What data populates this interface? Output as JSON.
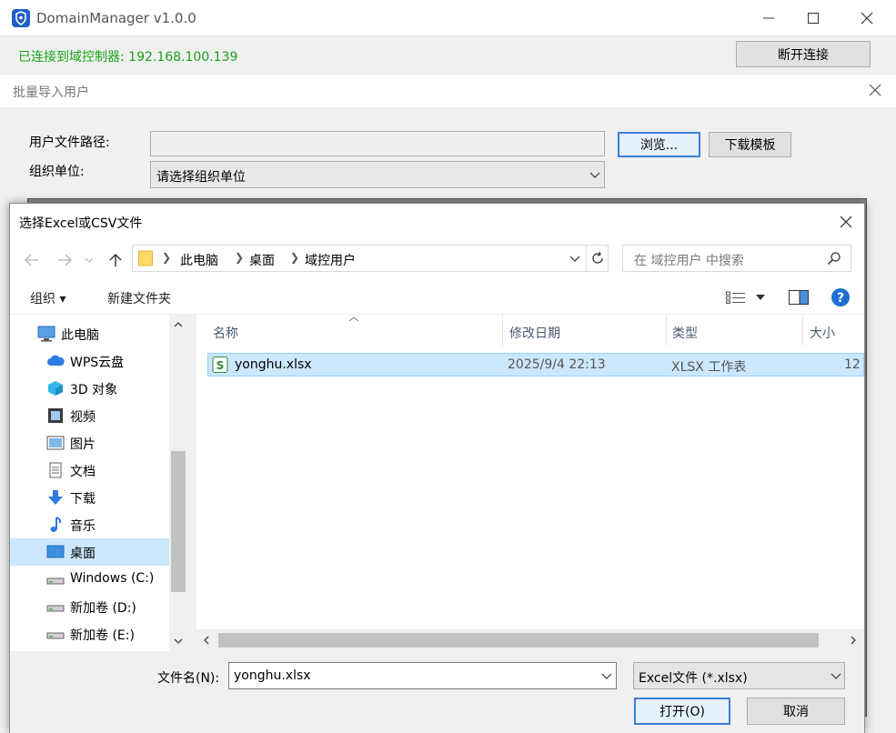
{
  "app": {
    "title": "DomainManager v1.0.0",
    "connection_status": "已连接到域控制器: 192.168.100.139",
    "disconnect_label": "断开连接",
    "colors": {
      "status_green": "#1aa31a",
      "accent_blue": "#1e5fc8"
    }
  },
  "batch_dialog": {
    "title": "批量导入用户",
    "file_path_label": "用户文件路径:",
    "file_path_value": "",
    "org_unit_label": "组织单位:",
    "org_unit_placeholder": "请选择组织单位",
    "browse_label": "浏览...",
    "download_template_label": "下载模板"
  },
  "file_dialog": {
    "title": "选择Excel或CSV文件",
    "breadcrumb": [
      "此电脑",
      "桌面",
      "域控用户"
    ],
    "search_placeholder": "在 域控用户 中搜索",
    "toolbar": {
      "organize": "组织 ▾",
      "new_folder": "新建文件夹"
    },
    "sidebar": [
      {
        "label": "此电脑",
        "icon": "computer-icon"
      },
      {
        "label": "WPS云盘",
        "icon": "cloud-icon"
      },
      {
        "label": "3D 对象",
        "icon": "cube-icon"
      },
      {
        "label": "视频",
        "icon": "video-icon"
      },
      {
        "label": "图片",
        "icon": "picture-icon"
      },
      {
        "label": "文档",
        "icon": "document-icon"
      },
      {
        "label": "下载",
        "icon": "download-icon"
      },
      {
        "label": "音乐",
        "icon": "music-icon"
      },
      {
        "label": "桌面",
        "icon": "desktop-icon"
      },
      {
        "label": "Windows (C:)",
        "icon": "drive-icon"
      },
      {
        "label": "新加卷 (D:)",
        "icon": "drive-icon"
      },
      {
        "label": "新加卷 (E:)",
        "icon": "drive-icon"
      }
    ],
    "columns": [
      "名称",
      "修改日期",
      "类型",
      "大小"
    ],
    "files": [
      {
        "name": "yonghu.xlsx",
        "modified": "2025/9/4 22:13",
        "type": "XLSX 工作表",
        "size": "12"
      }
    ],
    "filename_label": "文件名(N):",
    "filename_value": "yonghu.xlsx",
    "filter_value": "Excel文件 (*.xlsx)",
    "open_label": "打开(O)",
    "cancel_label": "取消"
  }
}
